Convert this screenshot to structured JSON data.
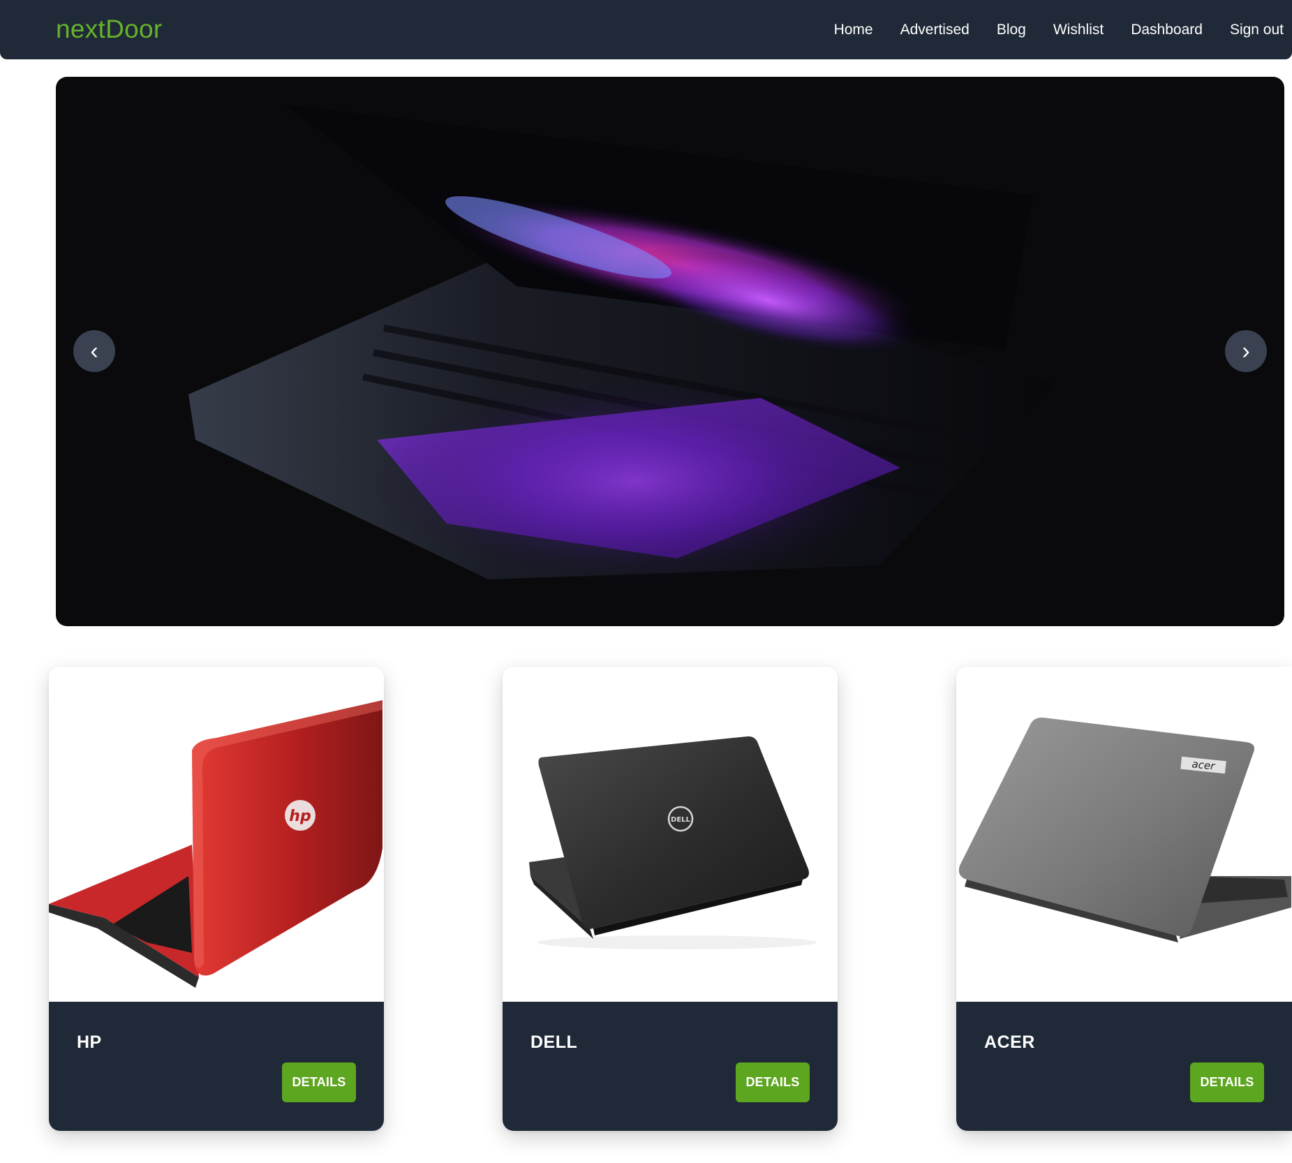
{
  "brand": "nextDoor",
  "colors": {
    "brand_green": "#66b22c",
    "navbar_bg": "#1f2937",
    "button_green": "#5da61f"
  },
  "nav": {
    "items": [
      {
        "label": "Home",
        "icon": ""
      },
      {
        "label": "Advertised",
        "icon": ""
      },
      {
        "label": "Blog",
        "icon": ""
      },
      {
        "label": "Wishlist",
        "icon": ""
      },
      {
        "label": "Dashboard",
        "icon": ""
      },
      {
        "label": "Sign out",
        "icon": ""
      }
    ]
  },
  "carousel": {
    "prev_symbol": "‹",
    "next_symbol": "›",
    "prev_icon": "chevron-left-icon",
    "next_icon": "chevron-right-icon"
  },
  "products": [
    {
      "title": "HP",
      "button": "DETAILS",
      "image": "red-hp-laptop"
    },
    {
      "title": "DELL",
      "button": "DETAILS",
      "image": "black-dell-laptop"
    },
    {
      "title": "ACER",
      "button": "DETAILS",
      "image": "gray-acer-laptop"
    }
  ],
  "logos": {
    "hp": "hp",
    "dell": "DELL",
    "acer": "acer"
  }
}
